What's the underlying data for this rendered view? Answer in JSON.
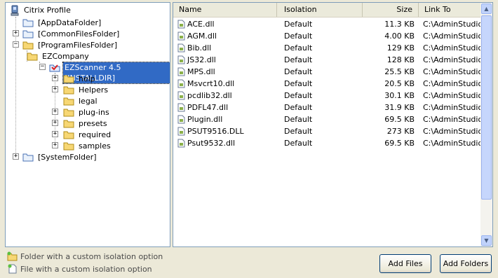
{
  "tree": {
    "root": "Citrix Profile",
    "items": [
      {
        "label": "[AppDataFolder]"
      },
      {
        "label": "[CommonFilesFolder]"
      },
      {
        "label": "[ProgramFilesFolder]"
      },
      {
        "label": "EZCompany"
      },
      {
        "label": "EZScanner 4.5 [INSTALLDIR]"
      },
      {
        "label": "help"
      },
      {
        "label": "Helpers"
      },
      {
        "label": "legal"
      },
      {
        "label": "plug-ins"
      },
      {
        "label": "presets"
      },
      {
        "label": "required"
      },
      {
        "label": "samples"
      },
      {
        "label": "[SystemFolder]"
      }
    ]
  },
  "list": {
    "columns": {
      "name": "Name",
      "isolation": "Isolation",
      "size": "Size",
      "link_to": "Link To"
    },
    "rows": [
      {
        "name": "ACE.dll",
        "isolation": "Default",
        "size": "11.3 KB",
        "link_to": "C:\\AdminStudio S"
      },
      {
        "name": "AGM.dll",
        "isolation": "Default",
        "size": "4.00 KB",
        "link_to": "C:\\AdminStudio S"
      },
      {
        "name": "Bib.dll",
        "isolation": "Default",
        "size": "129 KB",
        "link_to": "C:\\AdminStudio S"
      },
      {
        "name": "JS32.dll",
        "isolation": "Default",
        "size": "128 KB",
        "link_to": "C:\\AdminStudio S"
      },
      {
        "name": "MPS.dll",
        "isolation": "Default",
        "size": "25.5 KB",
        "link_to": "C:\\AdminStudio S"
      },
      {
        "name": "Msvcrt10.dll",
        "isolation": "Default",
        "size": "20.5 KB",
        "link_to": "C:\\AdminStudio S"
      },
      {
        "name": "pcdlib32.dll",
        "isolation": "Default",
        "size": "30.1 KB",
        "link_to": "C:\\AdminStudio S"
      },
      {
        "name": "PDFL47.dll",
        "isolation": "Default",
        "size": "31.9 KB",
        "link_to": "C:\\AdminStudio S"
      },
      {
        "name": "Plugin.dll",
        "isolation": "Default",
        "size": "69.5 KB",
        "link_to": "C:\\AdminStudio S"
      },
      {
        "name": "PSUT9516.DLL",
        "isolation": "Default",
        "size": "273 KB",
        "link_to": "C:\\AdminStudio S"
      },
      {
        "name": "Psut9532.dll",
        "isolation": "Default",
        "size": "69.5 KB",
        "link_to": "C:\\AdminStudio S"
      }
    ]
  },
  "legend": {
    "folder_text": "Folder with a custom isolation option",
    "file_text": "File with a custom isolation option"
  },
  "buttons": {
    "add_files": "Add Files",
    "add_folders": "Add Folders"
  },
  "colors": {
    "selection": "#316ac5",
    "folder": "#f7d774",
    "panel_border": "#7f9db9"
  }
}
